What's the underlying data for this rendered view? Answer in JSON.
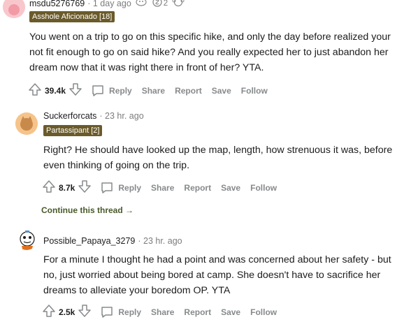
{
  "comments": [
    {
      "username": "msdu5276769",
      "time": "· 1 day ago",
      "awards": [
        {
          "icon": "helpful-award-icon",
          "count": ""
        },
        {
          "icon": "silver-award-icon",
          "count": "2"
        },
        {
          "icon": "wholesome-award-icon",
          "count": ""
        }
      ],
      "flair": "Asshole Aficionado [18]",
      "text": "You went on a trip to go on this specific hike, and only the day before realized your not fit enough to go on said hike? And you really expected her to just abandon her dream now that it was right there in front of her? YTA.",
      "score": "39.4k",
      "actions": {
        "reply": "Reply",
        "share": "Share",
        "report": "Report",
        "save": "Save",
        "follow": "Follow"
      }
    },
    {
      "username": "Suckerforcats",
      "time": "· 23 hr. ago",
      "flair": "Partassipant [2]",
      "text": "Right? He should have looked up the map, length, how strenuous it was, before even thinking of going on the trip.",
      "score": "8.7k",
      "actions": {
        "reply": "Reply",
        "share": "Share",
        "report": "Report",
        "save": "Save",
        "follow": "Follow"
      }
    },
    {
      "username": "Possible_Papaya_3279",
      "time": "· 23 hr. ago",
      "text": "For a minute I thought he had a point and was concerned about her safety - but no, just worried about being bored at camp. She doesn't have to sacrifice her dreams to alleviate your boredom OP. YTA",
      "score": "2.5k",
      "actions": {
        "reply": "Reply",
        "share": "Share",
        "report": "Report",
        "save": "Save",
        "follow": "Follow"
      }
    }
  ],
  "continue_thread": "Continue this thread →"
}
